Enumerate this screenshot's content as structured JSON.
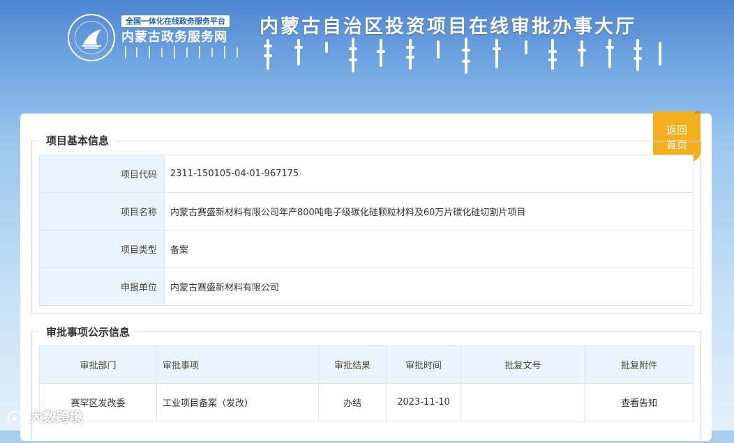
{
  "header": {
    "platform_badge": "全国一体化在线政务服务平台",
    "platform_name": "内蒙古政务服务网",
    "title": "内蒙古自治区投资项目在线审批办事大厅",
    "logo_icon": "inner-mongolia-gov-emblem-icon"
  },
  "back_button": {
    "line1": "返回",
    "line2": "首页"
  },
  "basic_info": {
    "legend": "项目基本信息",
    "rows": [
      {
        "label": "项目代码",
        "value": "2311-150105-04-01-967175"
      },
      {
        "label": "项目名称",
        "value": "内蒙古赛盛新材料有限公司年产800吨电子级碳化硅颗粒材料及60万片碳化硅切割片项目"
      },
      {
        "label": "项目类型",
        "value": "备案"
      },
      {
        "label": "申报单位",
        "value": "内蒙古赛盛新材料有限公司"
      }
    ]
  },
  "approval_info": {
    "legend": "审批事项公示信息",
    "columns": [
      "审批部门",
      "审批事项",
      "审批结果",
      "审批时间",
      "批复文号",
      "批复附件"
    ],
    "rows": [
      {
        "dept": "赛罕区发改委",
        "item": "工业项目备案（发改）",
        "result": "办结",
        "time": "2023-11-10",
        "doc_no": "",
        "attachment": "查看告知"
      }
    ]
  },
  "watermark": "大数跨境",
  "colors": {
    "accent_yellow": "#f2b01c",
    "header_blue": "#4f86d2",
    "label_bg": "#eaf4fc"
  }
}
